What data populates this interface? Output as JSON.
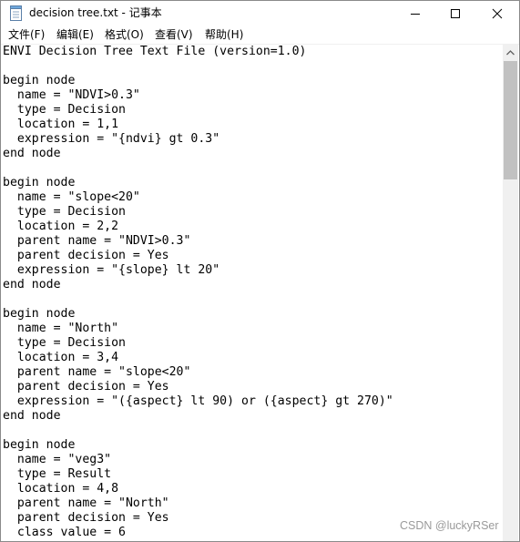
{
  "window": {
    "title": "decision tree.txt - 记事本"
  },
  "icons": {
    "app": "notepad-icon",
    "minimize": "minimize-icon",
    "maximize": "maximize-icon",
    "close": "close-icon",
    "scroll_up": "chevron-up-icon"
  },
  "menu": {
    "file": "文件(F)",
    "edit": "编辑(E)",
    "format": "格式(O)",
    "view": "查看(V)",
    "help": "帮助(H)"
  },
  "editor": {
    "lines": [
      "ENVI Decision Tree Text File (version=1.0)",
      "",
      "begin node",
      "  name = \"NDVI>0.3\"",
      "  type = Decision",
      "  location = 1,1",
      "  expression = \"{ndvi} gt 0.3\"",
      "end node",
      "",
      "begin node",
      "  name = \"slope<20\"",
      "  type = Decision",
      "  location = 2,2",
      "  parent name = \"NDVI>0.3\"",
      "  parent decision = Yes",
      "  expression = \"{slope} lt 20\"",
      "end node",
      "",
      "begin node",
      "  name = \"North\"",
      "  type = Decision",
      "  location = 3,4",
      "  parent name = \"slope<20\"",
      "  parent decision = Yes",
      "  expression = \"({aspect} lt 90) or ({aspect} gt 270)\"",
      "end node",
      "",
      "begin node",
      "  name = \"veg3\"",
      "  type = Result",
      "  location = 4,8",
      "  parent name = \"North\"",
      "  parent decision = Yes",
      "  class value = 6"
    ]
  },
  "watermark": "CSDN @luckyRSer"
}
